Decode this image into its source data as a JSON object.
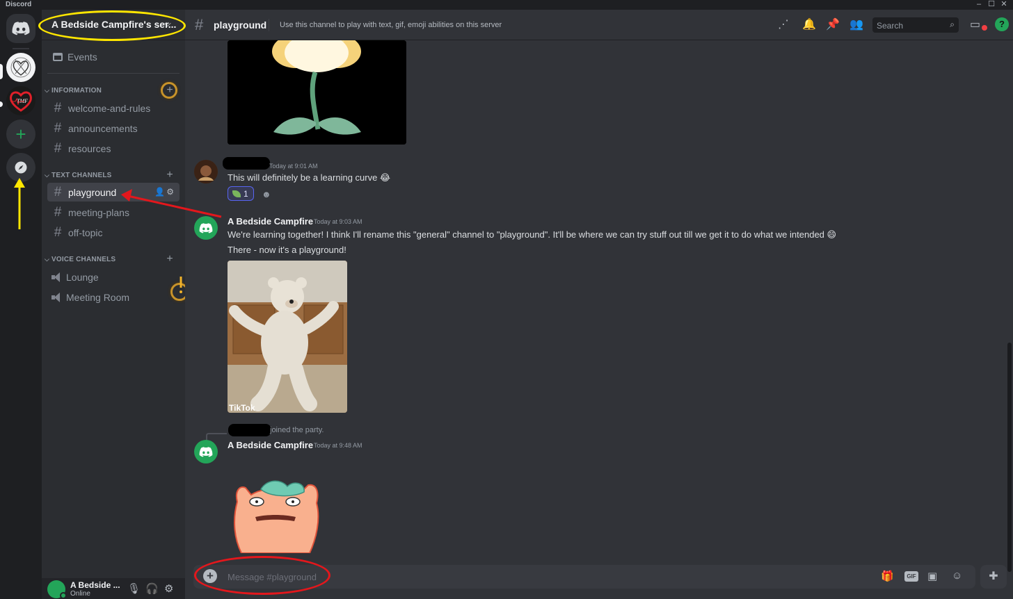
{
  "window": {
    "app_name": "Discord"
  },
  "server": {
    "name": "A Bedside Campfire's ser...",
    "events_label": "Events",
    "categories": [
      {
        "name": "INFORMATION",
        "channels": [
          "welcome-and-rules",
          "announcements",
          "resources"
        ]
      },
      {
        "name": "TEXT CHANNELS",
        "channels": [
          "playground",
          "meeting-plans",
          "off-topic"
        ]
      },
      {
        "name": "VOICE CHANNELS",
        "channels": [
          "Lounge",
          "Meeting Room"
        ]
      }
    ]
  },
  "user": {
    "name": "A Bedside ...",
    "status": "Online"
  },
  "channel": {
    "name": "playground",
    "topic": "Use this channel to play with text, gif, emoji abilities on this server"
  },
  "search": {
    "placeholder": "Search"
  },
  "messages": [
    {
      "timestamp": "Today at 9:01 AM",
      "text": "This will definitely be a learning curve 😂",
      "reaction_count": "1"
    },
    {
      "author": "A Bedside Campfire",
      "timestamp": "Today at 9:03 AM",
      "lines": [
        "We're learning together! I think I'll rename this \"general\" channel to \"playground\". It'll be where we can try stuff out till we get it to do what we intended 😄",
        "There - now it's a playground!"
      ],
      "gif_watermark": "TikTok"
    },
    {
      "system_text": "joined the party."
    },
    {
      "author": "A Bedside Campfire",
      "timestamp": "Today at 9:48 AM"
    }
  ],
  "composer": {
    "placeholder": "Message #playground",
    "gif_label": "GIF"
  },
  "colors": {
    "accent_green": "#23a559",
    "annotation_yellow": "#ffe600",
    "annotation_red": "#e3171c",
    "annotation_orange": "#c8932a"
  },
  "icons": [
    "discord-logo-icon",
    "add-server-icon",
    "compass-icon",
    "calendar-icon",
    "hash-icon",
    "speaker-icon",
    "threads-icon",
    "bell-icon",
    "pin-icon",
    "members-icon",
    "search-icon",
    "inbox-icon",
    "help-icon",
    "gift-icon",
    "gif-icon",
    "sticker-icon",
    "emoji-icon",
    "apps-icon",
    "mic-icon",
    "headphones-icon",
    "gear-icon"
  ]
}
